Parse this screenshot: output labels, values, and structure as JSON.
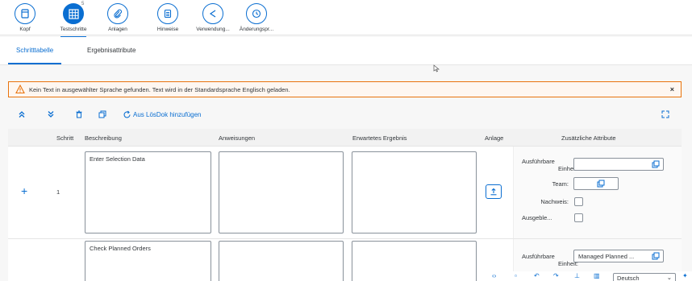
{
  "icon_tabs": [
    {
      "label": "Kopf",
      "icon": "document-icon"
    },
    {
      "label": "Testschritte",
      "icon": "table-grid-icon",
      "count": "5",
      "active": true
    },
    {
      "label": "Anlagen",
      "icon": "paperclip-icon"
    },
    {
      "label": "Hinweise",
      "icon": "notes-icon"
    },
    {
      "label": "Verwendung...",
      "icon": "share-icon"
    },
    {
      "label": "Änderungspr...",
      "icon": "history-clock-icon"
    }
  ],
  "sub_tabs": [
    {
      "label": "Schritttabelle",
      "active": true
    },
    {
      "label": "Ergebnisattribute"
    }
  ],
  "warning": {
    "text": "Kein Text in ausgewählter Sprache gefunden. Text wird in der Standardsprache Englisch geladen.",
    "close": "×"
  },
  "toolbar": {
    "add_from_doc": "Aus LösDok hinzufügen"
  },
  "table": {
    "headers": {
      "step": "Schritt",
      "description": "Beschreibung",
      "instructions": "Anweisungen",
      "expected": "Erwartetes Ergebnis",
      "attachment": "Anlage",
      "extra": "Zusätzliche Attribute"
    },
    "rows": [
      {
        "step": "1",
        "description": "Enter Selection Data",
        "instructions": "",
        "expected": "",
        "attrs": {
          "unit_label_1": "Ausführbare",
          "unit_label_2": "Einheit:",
          "unit_value": "",
          "team_label": "Team:",
          "team_value": "",
          "proof_label": "Nachweis:",
          "hidden_label": "Ausgeble..."
        }
      },
      {
        "step": "",
        "description": "Check Planned Orders",
        "instructions": "",
        "expected": "",
        "attrs": {
          "unit_label_1": "Ausführbare",
          "unit_label_2": "Einheit:",
          "unit_value": "Managed Planned ..."
        }
      }
    ]
  },
  "footer": {
    "language": "Deutsch"
  },
  "colors": {
    "accent": "#0a6ed1",
    "warning": "#e9730c"
  }
}
